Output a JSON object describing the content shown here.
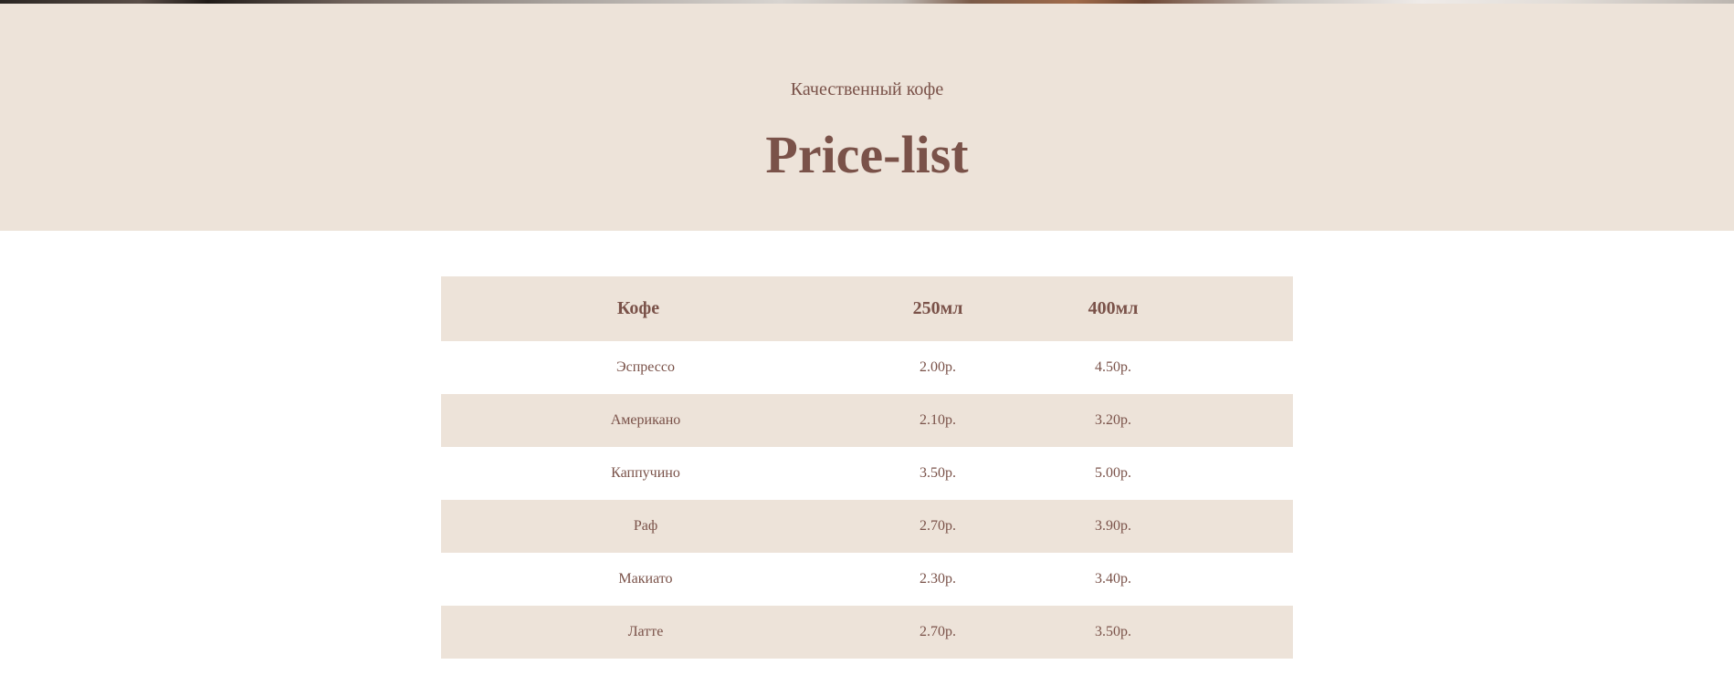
{
  "hero": {
    "subtitle": "Качественный кофе",
    "title": "Price-list"
  },
  "price_table": {
    "headers": {
      "name": "Кофе",
      "small": "250мл",
      "large": "400мл"
    },
    "rows": [
      {
        "name": "Эспрессо",
        "small": "2.00р.",
        "large": "4.50р."
      },
      {
        "name": "Американо",
        "small": "2.10р.",
        "large": "3.20р."
      },
      {
        "name": "Каппучино",
        "small": "3.50р.",
        "large": "5.00р."
      },
      {
        "name": "Раф",
        "small": "2.70р.",
        "large": "3.90р."
      },
      {
        "name": "Макиато",
        "small": "2.30р.",
        "large": "3.40р."
      },
      {
        "name": "Латте",
        "small": "2.70р.",
        "large": "3.50р."
      }
    ]
  },
  "colors": {
    "accent_text": "#7a5249",
    "band_background": "#ede3d9"
  }
}
